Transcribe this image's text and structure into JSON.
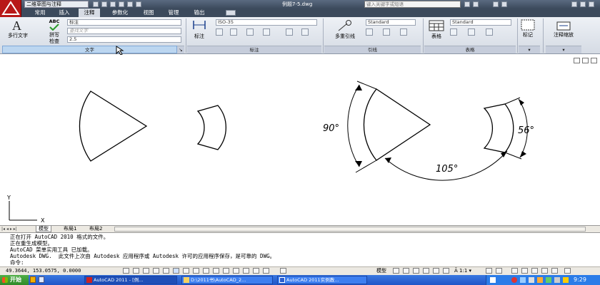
{
  "titlebar": {
    "workspace": "二维草图与注释",
    "doc_title": "例题7-5.dwg",
    "search_placeholder": "键入关键字或短语"
  },
  "tabs": [
    "常用",
    "插入",
    "注释",
    "参数化",
    "视图",
    "管理",
    "输出"
  ],
  "active_tab": "注释",
  "ribbon": {
    "text_panel": {
      "mtext_label": "多行文字",
      "abc_label": "ABC",
      "spell_label_1": "拼写",
      "spell_label_2": "检查",
      "style_value": "标注",
      "find_placeholder": "查找文字",
      "height_value": "2.5",
      "title": "文字"
    },
    "dim_panel": {
      "dim_label": "标注",
      "style_value": "ISO-35",
      "title": "标注"
    },
    "leader_panel": {
      "mleader_label": "多重引线",
      "style_value": "Standard",
      "title": "引线"
    },
    "table_panel": {
      "table_label": "表格",
      "style_value": "Standard",
      "title": "表格"
    },
    "mark_panel": {
      "label": "标记"
    },
    "scale_panel": {
      "label": "注释缩放"
    }
  },
  "drawing": {
    "dim_90": "90°",
    "dim_105": "105°",
    "dim_56": "56°",
    "ucs_x": "X",
    "ucs_y": "Y"
  },
  "layout_tabs": [
    "模型",
    "布局1",
    "布局2"
  ],
  "command_lines": [
    "正在打开 AutoCAD 2010 格式的文件。",
    "正在重生成模型。",
    "AutoCAD 菜单实用工具 已加载。",
    "Autodesk DWG.  此文件上次由 Autodesk 应用程序或 Autodesk 许可的应用程序保存，是可靠的 DWG。",
    "命令:"
  ],
  "statusbar": {
    "coords": "49.3644,  153.0575,  0.0000",
    "model": "模型",
    "scale": "1:1"
  },
  "taskbar": {
    "start": "开始",
    "buttons": [
      "AutoCAD 2011 - [例...",
      "D:\\2011书\\AutoCAD_2...",
      "AutoCAD 2011实例教..."
    ],
    "time": "9:29"
  },
  "colors": {
    "title_bar": "#3c4a5c",
    "ribbon": "#dde2ea",
    "taskbar": "#245edc",
    "start_button": "#3c9a34",
    "app_button": "#b81818"
  }
}
